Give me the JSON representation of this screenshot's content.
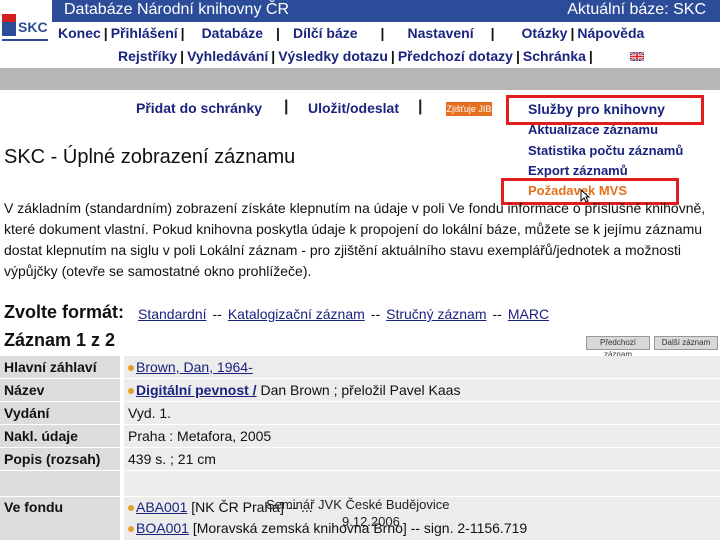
{
  "header": {
    "title": "Databáze Národní knihovny ČR",
    "current_base": "Aktuální báze:  SKC",
    "logo_text": "SKC"
  },
  "menu_primary": [
    "Konec",
    "Přihlášení",
    "Databáze",
    "Dílčí báze",
    "Nastavení",
    "Otázky",
    "Nápověda"
  ],
  "menu_secondary": [
    "Rejstříky",
    "Vyhledávání",
    "Výsledky dotazu",
    "Předchozí dotazy",
    "Schránka"
  ],
  "actions": {
    "add_to_basket": "Přidat do schránky",
    "save_send": "Uložit/odeslat",
    "zjistujeme": "Zjišťuje JIB",
    "services": "Služby pro knihovny"
  },
  "dropdown": [
    "Aktualizace záznamu",
    "Statistika počtu záznamů",
    "Export záznamů",
    "Požadavek MVS"
  ],
  "page_title": "SKC - Úplné zobrazení záznamu",
  "intro": "V základním (standardním) zobrazení získáte klepnutím na údaje v poli Ve fondu informace o příslušné knihovně, které dokument vlastní. Pokud knihovna poskytla údaje k propojení do lokální báze, můžete se k jejímu záznamu dostat klepnutím na siglu v poli Lokální záznam - pro zjištění aktuálního stavu exemplářů/jednotek a možnosti výpůjčky (otevře se samostatné okno prohlížeče).",
  "format": {
    "label": "Zvolte formát:",
    "options": [
      "Standardní",
      "Katalogizační záznam",
      "Stručný záznam",
      "MARC"
    ],
    "separator": "--"
  },
  "record_count": "Záznam 1 z 2",
  "nav": {
    "prev": "Předchozí záznam",
    "next": "Další záznam"
  },
  "record": {
    "hlavni_zahlavi": {
      "label": "Hlavní záhlaví",
      "value": "Brown, Dan, 1964-"
    },
    "nazev": {
      "label": "Název",
      "value_link": "Digitální pevnost /",
      "value_rest": " Dan Brown ; přeložil Pavel Kaas"
    },
    "vydani": {
      "label": "Vydání",
      "value": "Vyd. 1."
    },
    "nakl_udaje": {
      "label": "Nakl. údaje",
      "value": "Praha : Metafora, 2005"
    },
    "popis": {
      "label": "Popis (rozsah)",
      "value": "439 s. ; 21 cm"
    },
    "ve_fondu": {
      "label": "Ve fondu",
      "holdings": [
        {
          "sigla": "ABA001",
          "text": " [NK ČR Praha] -- ..."
        },
        {
          "sigla": "BOA001",
          "text": " [Moravská zemská knihovna Brno] -- sign. 2-1156.719"
        }
      ]
    }
  },
  "overlay": {
    "line1": "Seminář JVK České Budějovice",
    "line2": "9.12.2006"
  }
}
